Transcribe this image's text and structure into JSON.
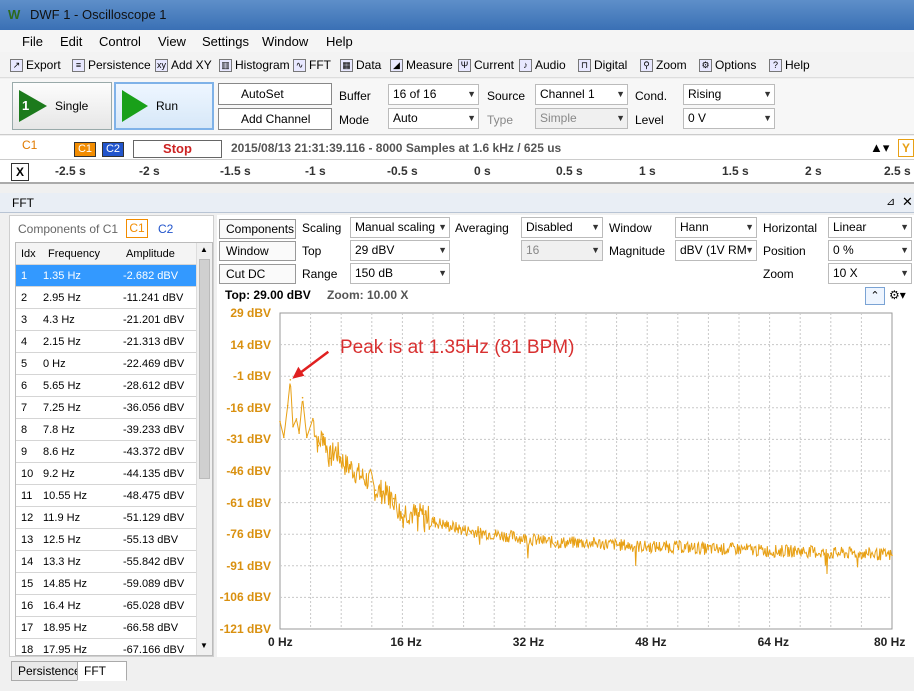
{
  "window": {
    "title": "DWF 1 - Oscilloscope 1",
    "logo": "W"
  },
  "menu": [
    "File",
    "Edit",
    "Control",
    "View",
    "Settings",
    "Window",
    "Help"
  ],
  "toolbar": [
    {
      "label": "Export",
      "icon": "export-icon"
    },
    {
      "label": "Persistence",
      "icon": "persistence-icon"
    },
    {
      "label": "Add XY",
      "icon": "add-xy-icon"
    },
    {
      "label": "Histogram",
      "icon": "histogram-icon"
    },
    {
      "label": "FFT",
      "icon": "fft-icon"
    },
    {
      "label": "Data",
      "icon": "data-icon"
    },
    {
      "label": "Measure",
      "icon": "measure-icon"
    },
    {
      "label": "Current",
      "icon": "current-icon"
    },
    {
      "label": "Audio",
      "icon": "audio-icon"
    },
    {
      "label": "Digital",
      "icon": "digital-icon"
    },
    {
      "label": "Zoom",
      "icon": "zoom-icon"
    },
    {
      "label": "Options",
      "icon": "options-icon"
    },
    {
      "label": "Help",
      "icon": "help-icon"
    }
  ],
  "controls": {
    "single": "Single",
    "run": "Run",
    "autoset": "AutoSet",
    "add_channel": "Add Channel",
    "buffer_label": "Buffer",
    "buffer_value": "16 of 16",
    "mode_label": "Mode",
    "mode_value": "Auto",
    "source_label": "Source",
    "source_value": "Channel 1",
    "type_label": "Type",
    "type_value": "Simple",
    "cond_label": "Cond.",
    "cond_value": "Rising",
    "level_label": "Level",
    "level_value": "0 V"
  },
  "status": {
    "channel": "C1",
    "c1": "C1",
    "c2": "C2",
    "stop": "Stop",
    "info": "2015/08/13 21:31:39.116 - 8000 Samples at 1.6 kHz / 625 us",
    "y": "Y"
  },
  "time_axis": {
    "x": "X",
    "ticks": [
      "-2.5 s",
      "-2 s",
      "-1.5 s",
      "-1 s",
      "-0.5 s",
      "0 s",
      "0.5 s",
      "1 s",
      "1.5 s",
      "2 s",
      "2.5 s"
    ]
  },
  "fft": {
    "title": "FFT",
    "components_label": "Components of C1",
    "c1": "C1",
    "c2": "C2",
    "table_headers": [
      "Idx",
      "Frequency",
      "Amplitude"
    ],
    "rows": [
      [
        "1",
        "1.35 Hz",
        "-2.682 dBV"
      ],
      [
        "2",
        "2.95 Hz",
        "-11.241 dBV"
      ],
      [
        "3",
        "4.3 Hz",
        "-21.201 dBV"
      ],
      [
        "4",
        "2.15 Hz",
        "-21.313 dBV"
      ],
      [
        "5",
        "0 Hz",
        "-22.469 dBV"
      ],
      [
        "6",
        "5.65 Hz",
        "-28.612 dBV"
      ],
      [
        "7",
        "7.25 Hz",
        "-36.056 dBV"
      ],
      [
        "8",
        "7.8 Hz",
        "-39.233 dBV"
      ],
      [
        "9",
        "8.6 Hz",
        "-43.372 dBV"
      ],
      [
        "10",
        "9.2 Hz",
        "-44.135 dBV"
      ],
      [
        "11",
        "10.55 Hz",
        "-48.475 dBV"
      ],
      [
        "12",
        "11.9 Hz",
        "-51.129 dBV"
      ],
      [
        "13",
        "12.5 Hz",
        "-55.13 dBV"
      ],
      [
        "14",
        "13.3 Hz",
        "-55.842 dBV"
      ],
      [
        "15",
        "14.85 Hz",
        "-59.089 dBV"
      ],
      [
        "16",
        "16.4 Hz",
        "-65.028 dBV"
      ],
      [
        "17",
        "18.95 Hz",
        "-66.58 dBV"
      ],
      [
        "18",
        "17.95 Hz",
        "-67.166 dBV"
      ]
    ],
    "settings": {
      "components_btn": "Components",
      "window_btn": "Window",
      "cutdc_btn": "Cut DC",
      "scaling_label": "Scaling",
      "scaling_value": "Manual scaling",
      "top_label": "Top",
      "top_value": "29 dBV",
      "range_label": "Range",
      "range_value": "150 dB",
      "averaging_label": "Averaging",
      "averaging_value": "Disabled",
      "averaging_count": "16",
      "window_label": "Window",
      "window_value": "Hann",
      "magnitude_label": "Magnitude",
      "magnitude_value": "dBV (1V RM",
      "horizontal_label": "Horizontal",
      "horizontal_value": "Linear",
      "position_label": "Position",
      "position_value": "0 %",
      "zoom_label": "Zoom",
      "zoom_value": "10 X"
    },
    "plot_info": {
      "top": "Top: 29.00 dBV",
      "zoom": "Zoom: 10.00 X"
    },
    "annotation": "Peak is at 1.35Hz (81 BPM)"
  },
  "chart_data": {
    "type": "line",
    "title": "",
    "xlabel": "",
    "ylabel": "",
    "xlim": [
      0,
      80
    ],
    "ylim": [
      -121,
      29
    ],
    "x_ticks": [
      "0 Hz",
      "16 Hz",
      "32 Hz",
      "48 Hz",
      "64 Hz",
      "80 Hz"
    ],
    "y_ticks": [
      "29 dBV",
      "14 dBV",
      "-1 dBV",
      "-16 dBV",
      "-31 dBV",
      "-46 dBV",
      "-61 dBV",
      "-76 dBV",
      "-91 dBV",
      "-106 dBV",
      "-121 dBV"
    ],
    "grid": true,
    "line_color": "#e8a014",
    "series": [
      {
        "x": [
          0,
          0.5,
          1,
          1.35,
          1.7,
          2.15,
          2.5,
          2.95,
          3.5,
          4.3,
          5,
          5.65,
          6.5,
          7.25,
          7.8,
          8.6,
          9.2,
          10.55,
          11.9,
          12.5,
          13.3,
          14.85,
          16,
          16.4,
          17.95,
          18.95,
          20,
          22,
          24,
          26,
          28,
          30,
          32,
          36,
          40,
          44,
          48,
          52,
          56,
          60,
          64,
          68,
          72,
          76,
          80
        ],
        "y": [
          -22.5,
          -30,
          -15,
          -2.7,
          -25,
          -21.3,
          -28,
          -11.2,
          -30,
          -21.2,
          -34,
          -28.6,
          -40,
          -36.1,
          -39.2,
          -43.4,
          -44.1,
          -48.5,
          -51.1,
          -55.1,
          -55.8,
          -59.1,
          -68,
          -65,
          -67.2,
          -66.6,
          -70,
          -72,
          -74,
          -75,
          -76,
          -77,
          -78,
          -80,
          -80,
          -81,
          -82,
          -82,
          -83,
          -83,
          -84,
          -84,
          -85,
          -85,
          -86
        ]
      }
    ]
  },
  "bottom_tabs": [
    "Persistence",
    "FFT"
  ]
}
